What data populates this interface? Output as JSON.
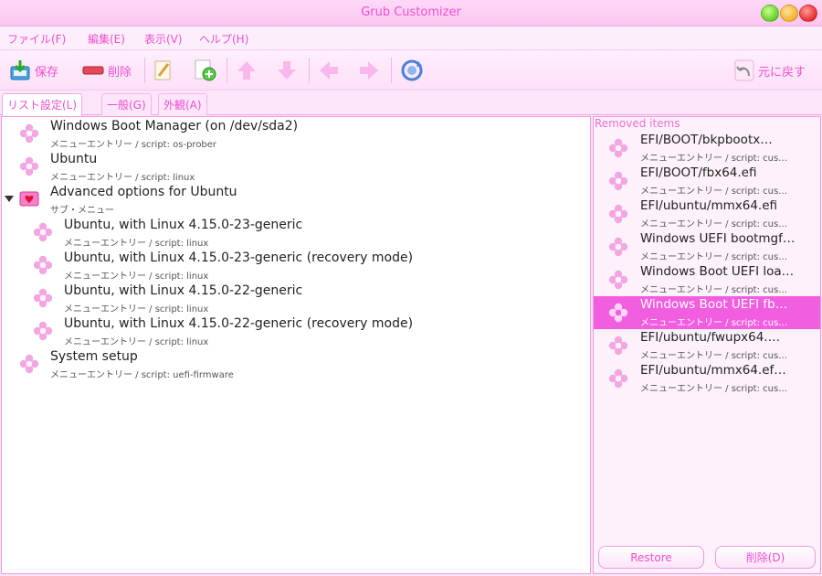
{
  "window": {
    "title": "Grub Customizer"
  },
  "menubar": {
    "items": [
      "ファイル(F)",
      "編集(E)",
      "表示(V)",
      "ヘルプ(H)"
    ]
  },
  "toolbar": {
    "save": "保存",
    "delete": "削除",
    "revert": "元に戻す"
  },
  "tabs": [
    "リスト設定(L)",
    "一般(G)",
    "外観(A)"
  ],
  "entries": [
    {
      "title": "Windows Boot Manager (on /dev/sda2)",
      "subtitle": "メニューエントリー / script: os-prober"
    },
    {
      "title": "Ubuntu",
      "subtitle": "メニューエントリー / script: linux"
    },
    {
      "title": "Advanced options for Ubuntu",
      "subtitle": "サブ・メニュー"
    },
    {
      "title": "Ubuntu, with Linux 4.15.0-23-generic",
      "subtitle": "メニューエントリー / script: linux"
    },
    {
      "title": "Ubuntu, with Linux 4.15.0-23-generic (recovery mode)",
      "subtitle": "メニューエントリー / script: linux"
    },
    {
      "title": "Ubuntu, with Linux 4.15.0-22-generic",
      "subtitle": "メニューエントリー / script: linux"
    },
    {
      "title": "Ubuntu, with Linux 4.15.0-22-generic (recovery mode)",
      "subtitle": "メニューエントリー / script: linux"
    },
    {
      "title": "System setup",
      "subtitle": "メニューエントリー / script: uefi-firmware"
    }
  ],
  "removed": {
    "header": "Removed items",
    "items": [
      {
        "title": "EFI/BOOT/bkpbootx…",
        "subtitle": "メニューエントリー / script: cus…"
      },
      {
        "title": "EFI/BOOT/fbx64.efi",
        "subtitle": "メニューエントリー / script: cus…"
      },
      {
        "title": "EFI/ubuntu/mmx64.efi",
        "subtitle": "メニューエントリー / script: cus…"
      },
      {
        "title": "Windows UEFI bootmgf…",
        "subtitle": "メニューエントリー / script: cus…"
      },
      {
        "title": "Windows Boot UEFI loa…",
        "subtitle": "メニューエントリー / script: cus…"
      },
      {
        "title": "Windows Boot UEFI fb…",
        "subtitle": "メニューエントリー / script: cus…"
      },
      {
        "title": "EFI/ubuntu/fwupx64.…",
        "subtitle": "メニューエントリー / script: cus…"
      },
      {
        "title": "EFI/ubuntu/mmx64.ef…",
        "subtitle": "メニューエントリー / script: cus…"
      }
    ],
    "restore": "Restore",
    "delete": "削除(D)"
  },
  "colors": {
    "accent": "#f04fd0",
    "selected": "#f25ee0",
    "border": "#f09ae0"
  }
}
